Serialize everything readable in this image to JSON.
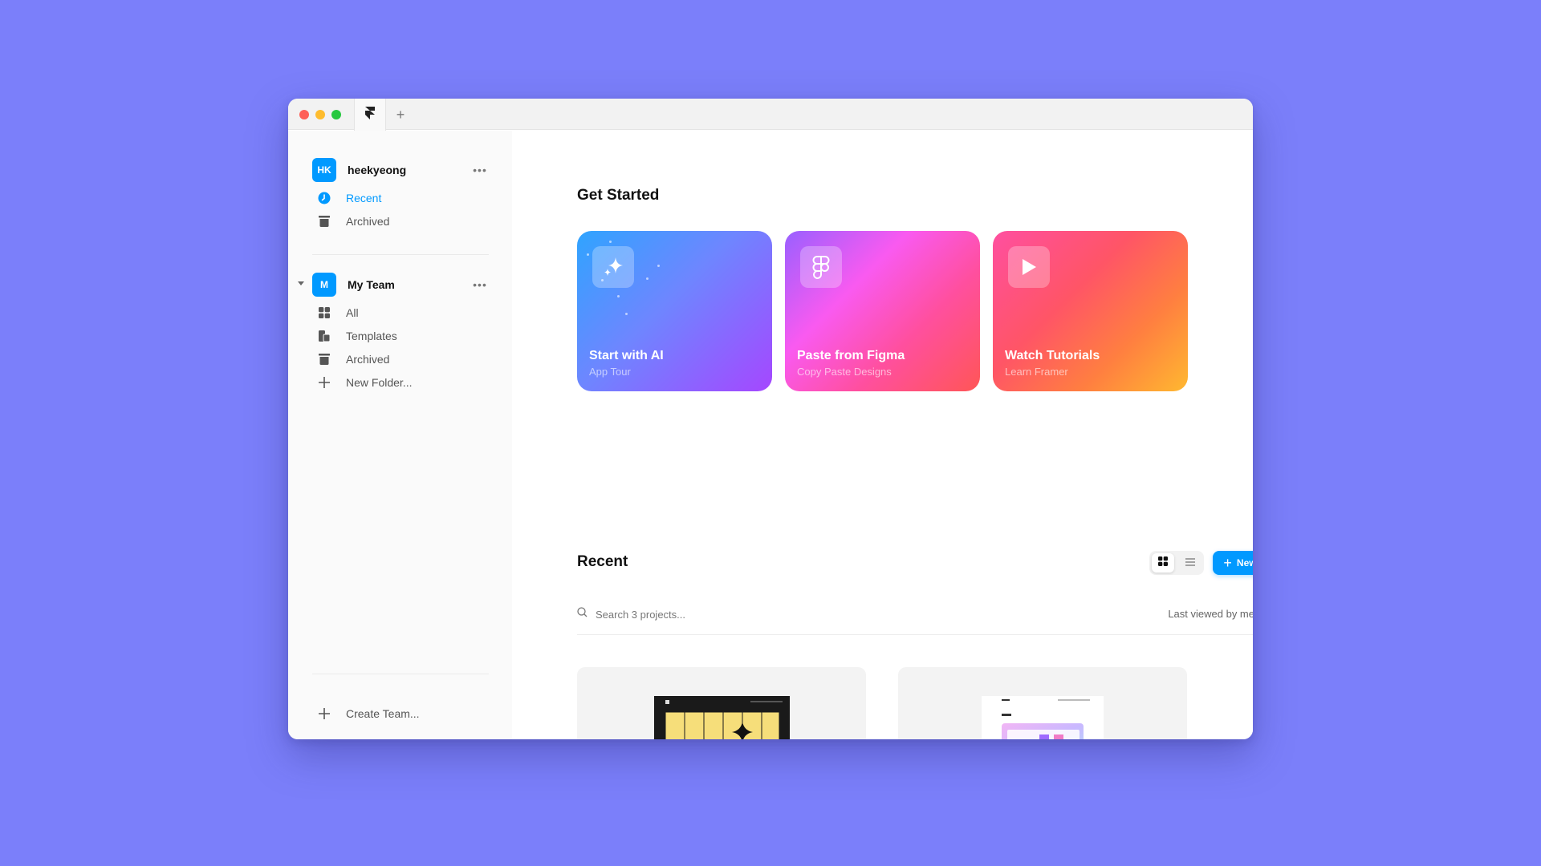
{
  "window": {
    "tabs": [
      {
        "icon": "framer-logo-icon",
        "active": true
      }
    ],
    "new_tab_label": "+"
  },
  "sidebar": {
    "account": {
      "initials": "HK",
      "name": "heekyeong",
      "more_label": "•••"
    },
    "personal_items": [
      {
        "label": "Recent",
        "icon": "clock-icon",
        "active": true
      },
      {
        "label": "Archived",
        "icon": "trash-icon",
        "active": false
      }
    ],
    "team": {
      "initials": "M",
      "name": "My Team",
      "more_label": "•••",
      "expanded": true,
      "items": [
        {
          "label": "All",
          "icon": "grid-icon"
        },
        {
          "label": "Templates",
          "icon": "templates-icon"
        },
        {
          "label": "Archived",
          "icon": "trash-icon"
        },
        {
          "label": "New Folder...",
          "icon": "plus-icon"
        }
      ]
    },
    "create_team_label": "Create Team..."
  },
  "main": {
    "get_started": {
      "title": "Get Started",
      "cards": [
        {
          "title": "Start with AI",
          "subtitle": "App Tour",
          "icon": "sparkles-icon"
        },
        {
          "title": "Paste from Figma",
          "subtitle": "Copy Paste Designs",
          "icon": "figma-icon"
        },
        {
          "title": "Watch Tutorials",
          "subtitle": "Learn Framer",
          "icon": "play-icon"
        }
      ]
    },
    "recent": {
      "title": "Recent",
      "view_mode": "grid",
      "new_button_label": "New",
      "search": {
        "placeholder": "Search 3 projects...",
        "value": ""
      },
      "sort": {
        "selected": "Last viewed by me"
      },
      "projects": [
        {
          "thumbnail": "dark-portfolio-site-preview"
        },
        {
          "thumbnail": "blog-site-preview"
        }
      ]
    }
  },
  "colors": {
    "background": "#7B7FFA",
    "accent": "#0099FF",
    "sidebar_bg": "#FAFAFA",
    "titlebar_bg": "#F2F2F2"
  }
}
